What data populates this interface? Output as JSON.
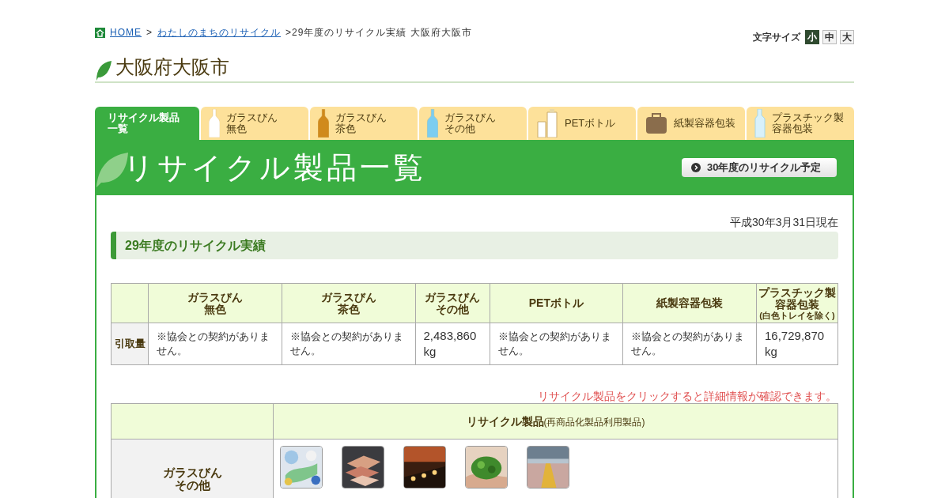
{
  "breadcrumb": {
    "links": [
      "HOME",
      "わたしのまちのリサイクル"
    ],
    "separator": ">",
    "current": ">29年度のリサイクル実績 大阪府大阪市"
  },
  "font_size": {
    "label": "文字サイズ",
    "buttons": [
      {
        "label": "小",
        "selected": true
      },
      {
        "label": "中",
        "selected": false
      },
      {
        "label": "大",
        "selected": false
      }
    ]
  },
  "page_title": "大阪府大阪市",
  "tabs": [
    {
      "lines": [
        "リサイクル製品",
        "一覧"
      ],
      "selected": true,
      "kind": "none"
    },
    {
      "lines": [
        "ガラスびん",
        "無色"
      ],
      "selected": false,
      "kind": "bottle-clear"
    },
    {
      "lines": [
        "ガラスびん",
        "茶色"
      ],
      "selected": false,
      "kind": "bottle-brown"
    },
    {
      "lines": [
        "ガラスびん",
        "その他"
      ],
      "selected": false,
      "kind": "bottle-blue"
    },
    {
      "lines": [
        "PETボトル"
      ],
      "selected": false,
      "kind": "pet"
    },
    {
      "lines": [
        "紙製容器包装"
      ],
      "selected": false,
      "kind": "carton"
    },
    {
      "lines": [
        "プラスチック製",
        "容器包装"
      ],
      "selected": false,
      "kind": "plastic"
    }
  ],
  "banner": {
    "title": "リサイクル製品一覧",
    "button": "30年度のリサイクル予定"
  },
  "date": "平成30年3月31日現在",
  "section_heading": "29年度のリサイクル実績",
  "results_table": {
    "columns": [
      {
        "lines": [
          "ガラスびん",
          "無色"
        ]
      },
      {
        "lines": [
          "ガラスびん",
          "茶色"
        ]
      },
      {
        "lines": [
          "ガラスびん",
          "その他"
        ]
      },
      {
        "lines": [
          "PETボトル"
        ]
      },
      {
        "lines": [
          "紙製容器包装"
        ]
      },
      {
        "lines": [
          "プラスチック製",
          "容器包装"
        ],
        "note": "(白色トレイを除く)"
      }
    ],
    "row_header": "引取量",
    "cells": [
      {
        "kind": "note",
        "text": "※協会との契約がありません。"
      },
      {
        "kind": "note",
        "text": "※協会との契約がありません。"
      },
      {
        "kind": "amount",
        "text": "2,483,860 kg"
      },
      {
        "kind": "note",
        "text": "※協会との契約がありません。"
      },
      {
        "kind": "note",
        "text": "※協会との契約がありません。"
      },
      {
        "kind": "amount",
        "text": "16,729,870 kg"
      }
    ]
  },
  "click_note": "リサイクル製品をクリックすると詳細情報が確認できます。",
  "products_table": {
    "heading": "リサイクル製品",
    "heading_suffix": "(再商品化製品利用製品)",
    "rows": [
      {
        "lines": [
          "ガラスびん",
          "その他"
        ],
        "products": [
          {
            "kind": "picture"
          },
          {
            "kind": "picture"
          },
          {
            "kind": "picture"
          },
          {
            "kind": "picture"
          },
          {
            "kind": "picture"
          }
        ]
      }
    ]
  }
}
